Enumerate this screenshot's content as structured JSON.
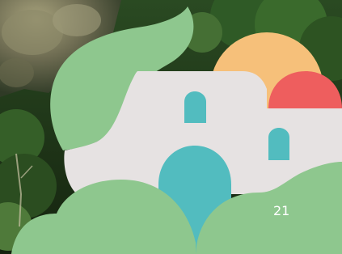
{
  "slide": {
    "page_number": "21"
  },
  "colors": {
    "green": "#8ec78e",
    "wall": "#e6e2e2",
    "sun": "#f6c07a",
    "red_dome": "#ee5e5e",
    "teal": "#52bcbf",
    "forest_dark": "#1f3a1c",
    "rock": "#8a8a6e"
  }
}
